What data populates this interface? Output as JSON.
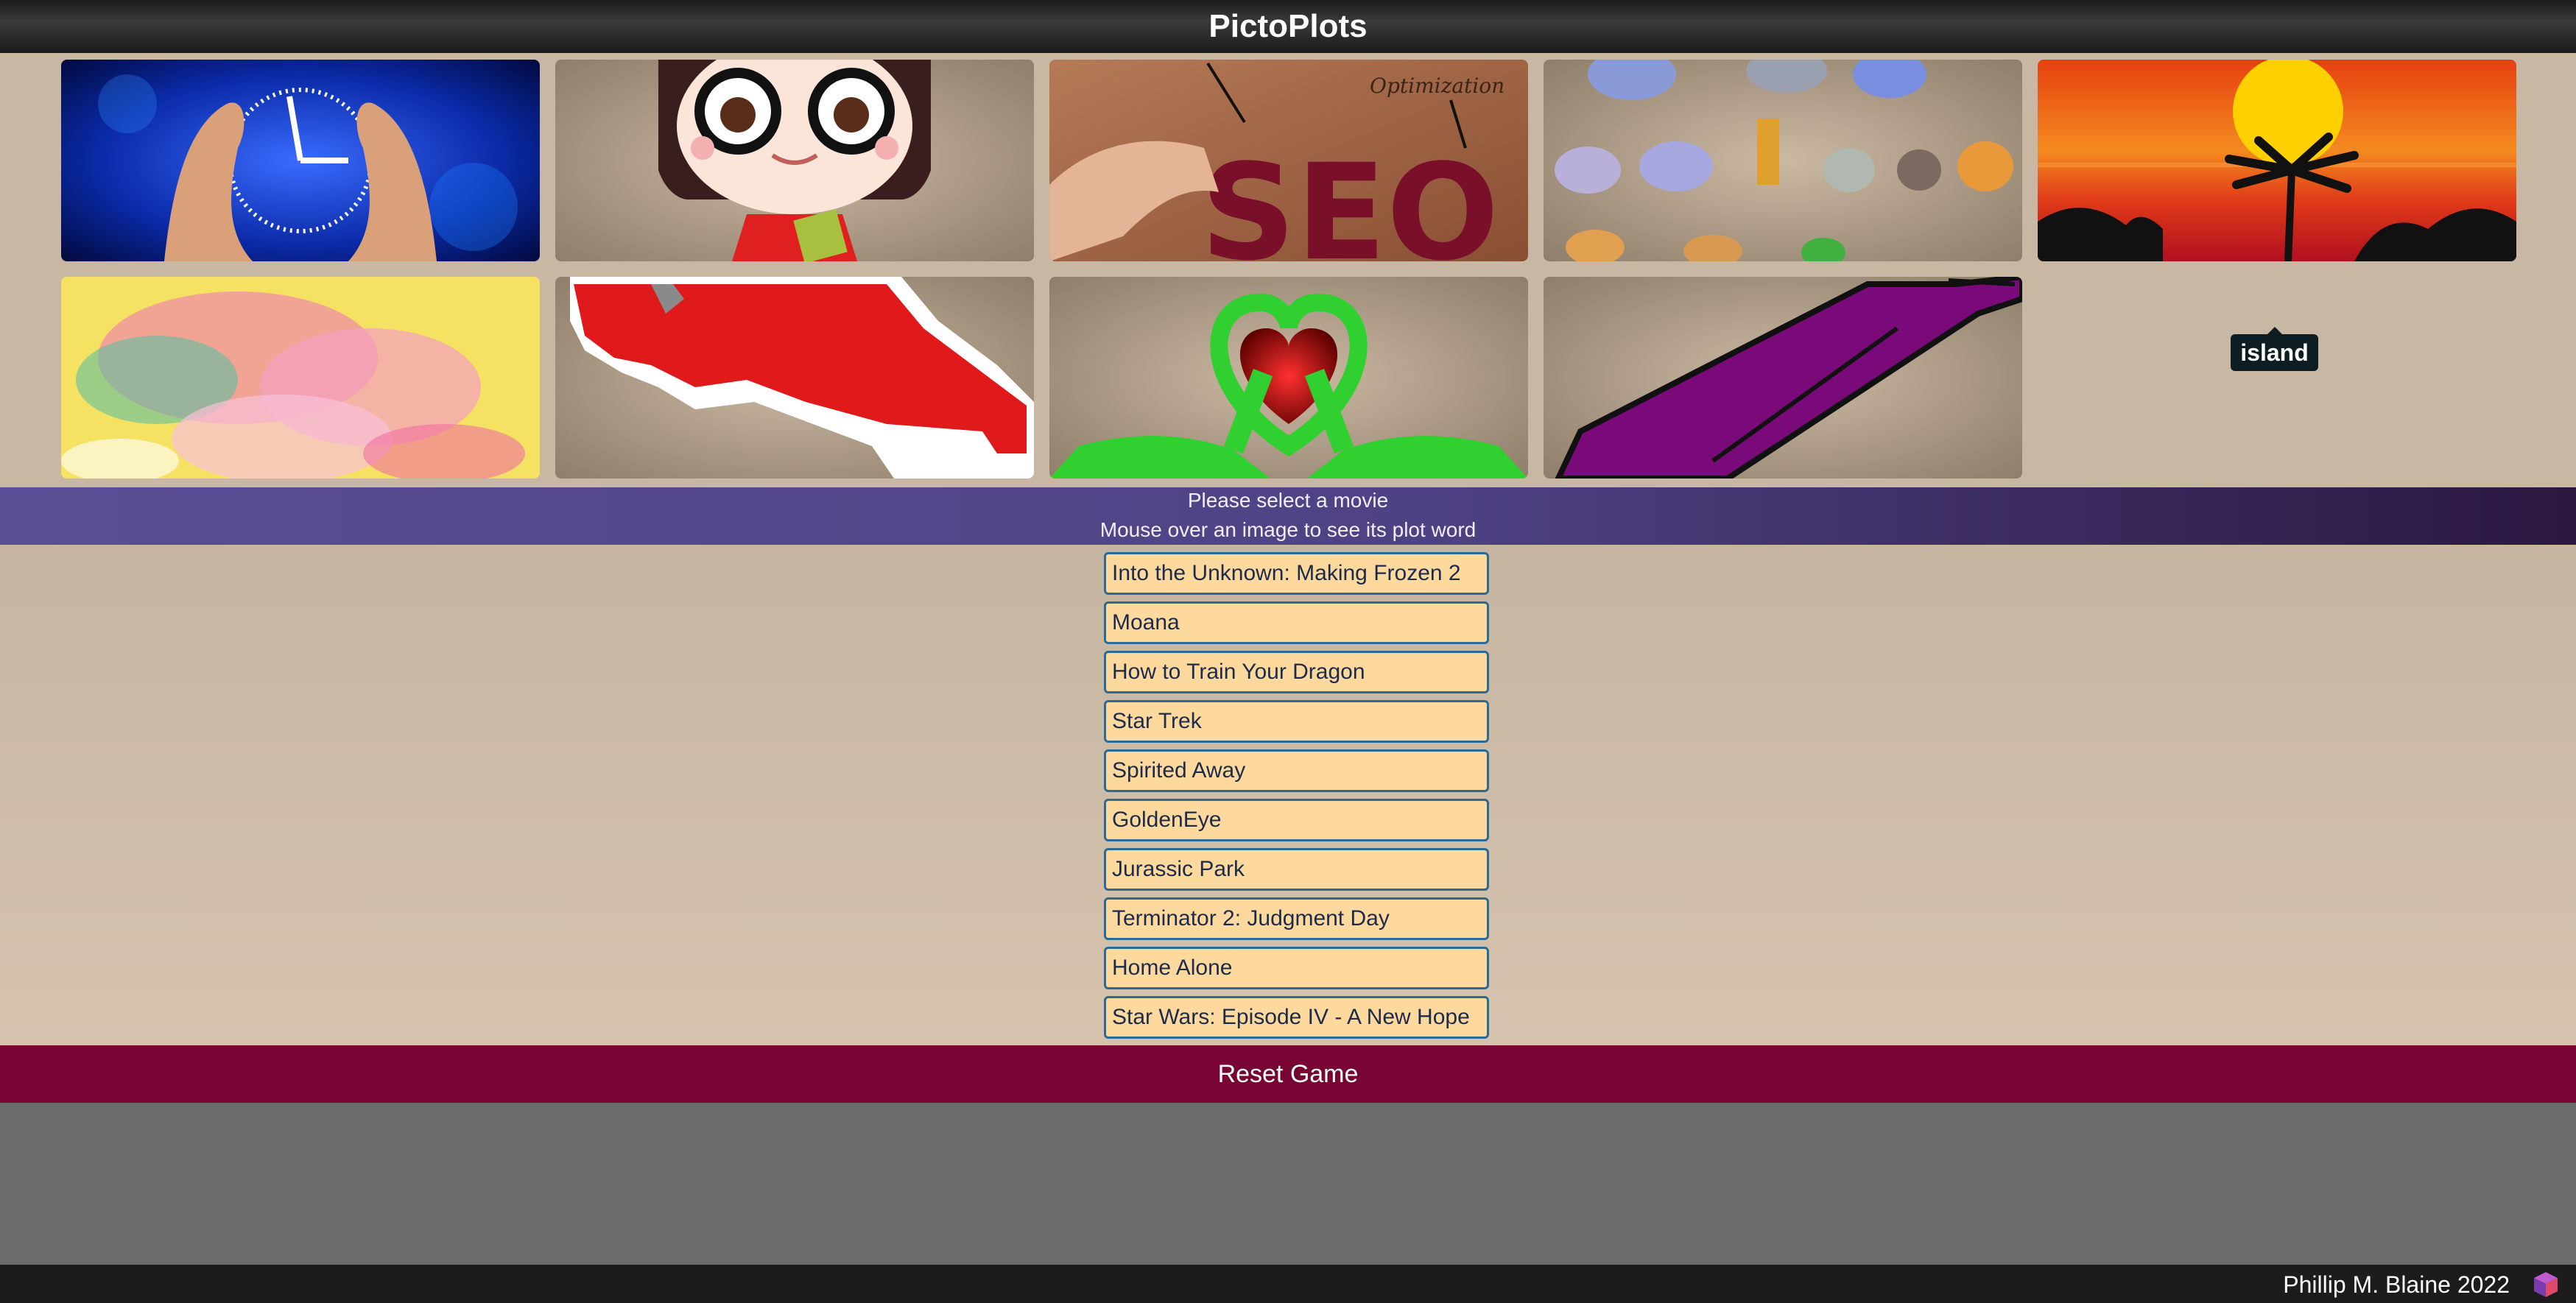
{
  "app": {
    "title": "PictoPlots"
  },
  "gallery": {
    "tiles": [
      {
        "name": "clock-hands-image",
        "word": "time"
      },
      {
        "name": "glasses-girl-image",
        "word": "girl"
      },
      {
        "name": "seo-image",
        "word": "optimization"
      },
      {
        "name": "animals-image",
        "word": "animals"
      },
      {
        "name": "sunset-palm-image",
        "word": "island"
      },
      {
        "name": "watercolor-image",
        "word": "color"
      },
      {
        "name": "map-image",
        "word": "map"
      },
      {
        "name": "dinosaur-heart-image",
        "word": "dinosaur"
      },
      {
        "name": "purple-bottle-image",
        "word": "bottle"
      }
    ],
    "seo_text": "Optimization",
    "seo_letters": "SEO",
    "tooltip": "island"
  },
  "instructions": {
    "line1": "Please select a movie",
    "line2": "Mouse over an image to see its plot word"
  },
  "movies": [
    "Into the Unknown: Making Frozen 2",
    "Moana",
    "How to Train Your Dragon",
    "Star Trek",
    "Spirited Away",
    "GoldenEye",
    "Jurassic Park",
    "Terminator 2: Judgment Day",
    "Home Alone",
    "Star Wars: Episode IV - A New Hope"
  ],
  "reset_label": "Reset Game",
  "footer": {
    "credit": "Phillip M. Blaine 2022",
    "logo_icon": "cube-icon"
  },
  "colors": {
    "header": "#2a2a2a",
    "band": "#5a4e94",
    "button_bg": "#fed99e",
    "button_border": "#2a6a94",
    "reset_bg": "#780433"
  }
}
